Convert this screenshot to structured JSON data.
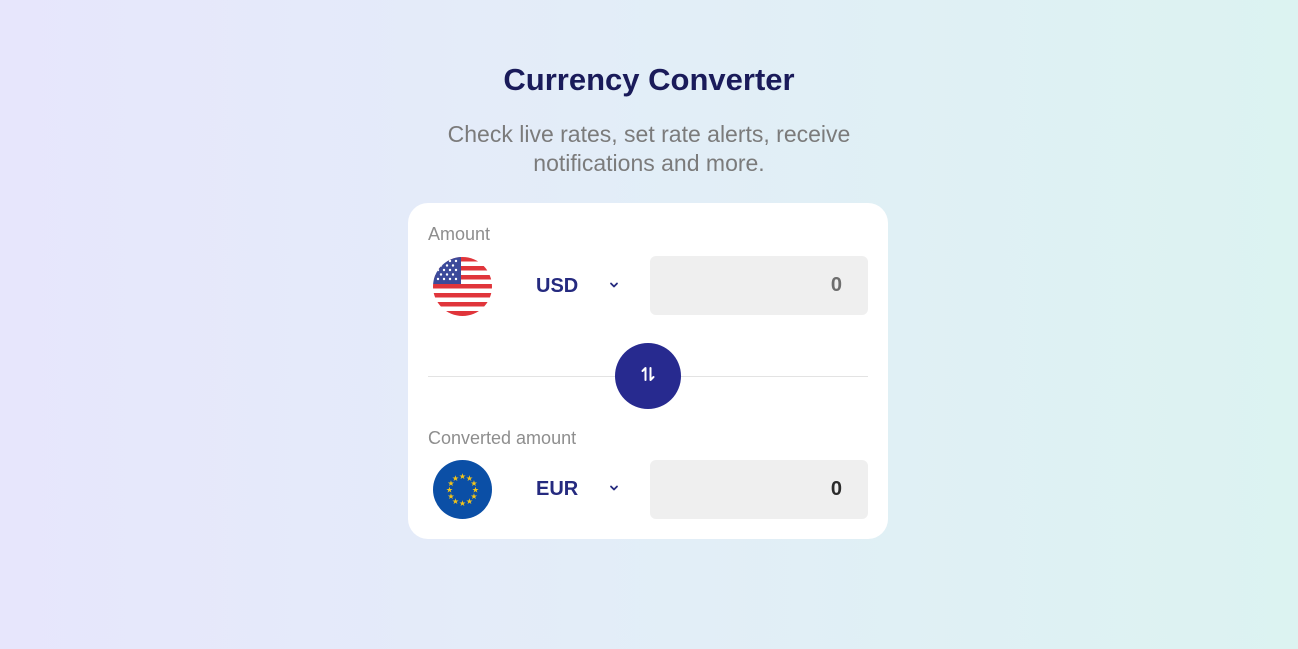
{
  "header": {
    "title": "Currency Converter",
    "subtitle": "Check live rates, set rate alerts, receive notifications and more."
  },
  "converter": {
    "from": {
      "label": "Amount",
      "currency": "USD",
      "flag_icon": "us-flag-icon",
      "value": "0"
    },
    "to": {
      "label": "Converted amount",
      "currency": "EUR",
      "flag_icon": "eu-flag-icon",
      "value": "0"
    },
    "swap_icon": "swap-arrows-icon"
  },
  "colors": {
    "title": "#1a1b5a",
    "accent": "#272a8f",
    "currency_text": "#252a7f",
    "card_background": "#ffffff",
    "input_background": "#efefef"
  }
}
